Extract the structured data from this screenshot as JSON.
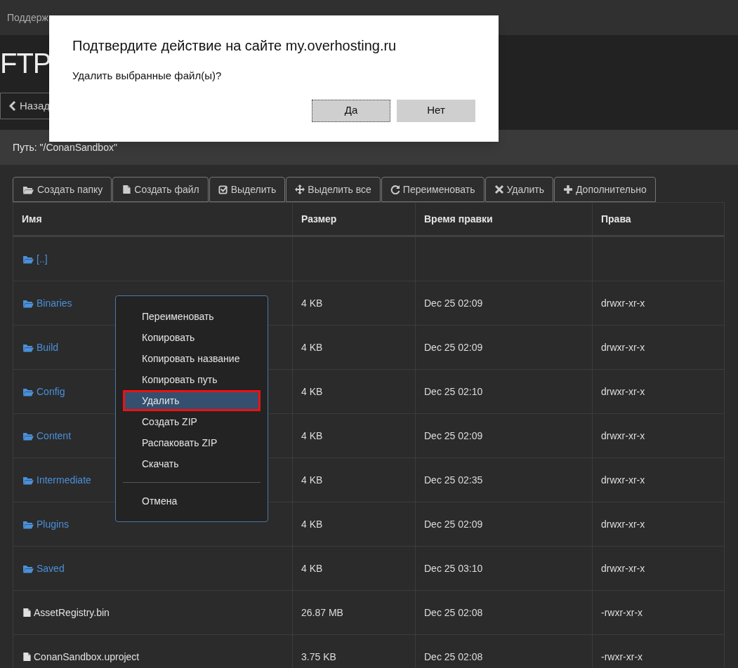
{
  "top_nav": {
    "link": "Поддерж"
  },
  "header": {
    "title": "FTP",
    "back_button": "Назад"
  },
  "path": "Путь: \"/ConanSandbox\"",
  "toolbar": [
    {
      "label": "Создать папку",
      "kind": "folder"
    },
    {
      "label": "Создать файл",
      "kind": "file"
    },
    {
      "label": "Выделить",
      "kind": "check"
    },
    {
      "label": "Выделить все",
      "kind": "move"
    },
    {
      "label": "Переименовать",
      "kind": "refresh"
    },
    {
      "label": "Удалить",
      "kind": "x"
    },
    {
      "label": "Дополнительно",
      "kind": "plus"
    }
  ],
  "table": {
    "columns": [
      "Имя",
      "Размер",
      "Время правки",
      "Права"
    ],
    "rows": [
      {
        "kind": "folder",
        "name": "[..]"
      },
      {
        "kind": "folder",
        "name": "Binaries",
        "size": "4 KB",
        "modified": "Dec 25 02:09",
        "permissions": "drwxr-xr-x"
      },
      {
        "kind": "folder",
        "name": "Build",
        "size": "4 KB",
        "modified": "Dec 25 02:09",
        "permissions": "drwxr-xr-x"
      },
      {
        "kind": "folder",
        "name": "Config",
        "size": "4 KB",
        "modified": "Dec 25 02:10",
        "permissions": "drwxr-xr-x"
      },
      {
        "kind": "folder",
        "name": "Content",
        "size": "4 KB",
        "modified": "Dec 25 02:09",
        "permissions": "drwxr-xr-x"
      },
      {
        "kind": "folder",
        "name": "Intermediate",
        "size": "4 KB",
        "modified": "Dec 25 02:35",
        "permissions": "drwxr-xr-x"
      },
      {
        "kind": "folder",
        "name": "Plugins",
        "size": "4 KB",
        "modified": "Dec 25 02:09",
        "permissions": "drwxr-xr-x"
      },
      {
        "kind": "folder",
        "name": "Saved",
        "size": "4 KB",
        "modified": "Dec 25 03:10",
        "permissions": "drwxr-xr-x"
      },
      {
        "kind": "file",
        "name": "AssetRegistry.bin",
        "size": "26.87 MB",
        "modified": "Dec 25 02:08",
        "permissions": "-rwxr-xr-x"
      },
      {
        "kind": "file",
        "name": "ConanSandbox.uproject",
        "size": "3.75 KB",
        "modified": "Dec 25 02:08",
        "permissions": "-rwxr-xr-x"
      }
    ]
  },
  "context_menu": {
    "groups": [
      [
        {
          "label": "Переименовать",
          "selected": false
        },
        {
          "label": "Копировать",
          "selected": false
        },
        {
          "label": "Копировать название",
          "selected": false
        },
        {
          "label": "Копировать путь",
          "selected": false
        },
        {
          "label": "Удалить",
          "selected": true
        },
        {
          "label": "Создать ZIP",
          "selected": false
        },
        {
          "label": "Распаковать ZIP",
          "selected": false
        },
        {
          "label": "Скачать",
          "selected": false
        }
      ],
      [
        {
          "label": "Отмена",
          "selected": false
        }
      ]
    ]
  },
  "dialog": {
    "title": "Подтвердите действие на сайте my.overhosting.ru",
    "message": "Удалить выбранные файл(ы)?",
    "buttons": [
      "Да",
      "Нет"
    ]
  }
}
